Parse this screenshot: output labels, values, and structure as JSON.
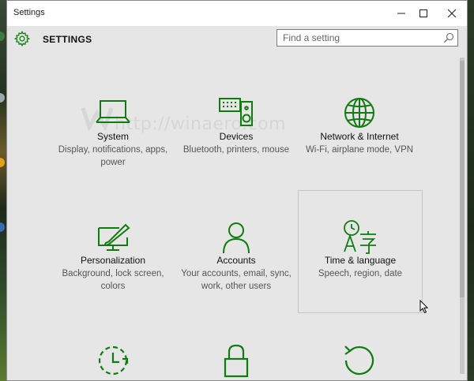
{
  "window": {
    "title": "Settings"
  },
  "header": {
    "title": "SETTINGS",
    "search_placeholder": "Find a setting"
  },
  "watermark": "http://winaero.com",
  "tiles": [
    {
      "name": "System",
      "desc": "Display, notifications, apps, power",
      "icon": "laptop-icon"
    },
    {
      "name": "Devices",
      "desc": "Bluetooth, printers, mouse",
      "icon": "keyboard-speaker-icon"
    },
    {
      "name": "Network & Internet",
      "desc": "Wi-Fi, airplane mode, VPN",
      "icon": "globe-icon"
    },
    {
      "name": "Personalization",
      "desc": "Background, lock screen, colors",
      "icon": "paint-brush-icon"
    },
    {
      "name": "Accounts",
      "desc": "Your accounts, email, sync, work, other users",
      "icon": "person-icon"
    },
    {
      "name": "Time & language",
      "desc": "Speech, region, date",
      "icon": "time-language-icon"
    },
    {
      "name": "",
      "desc": "",
      "icon": "update-icon"
    },
    {
      "name": "",
      "desc": "",
      "icon": "lock-icon"
    },
    {
      "name": "",
      "desc": "",
      "icon": "history-icon"
    }
  ],
  "colors": {
    "accent": "#107c10",
    "window_bg": "#e6e6e6",
    "selected_border": "#c4c4c4"
  }
}
